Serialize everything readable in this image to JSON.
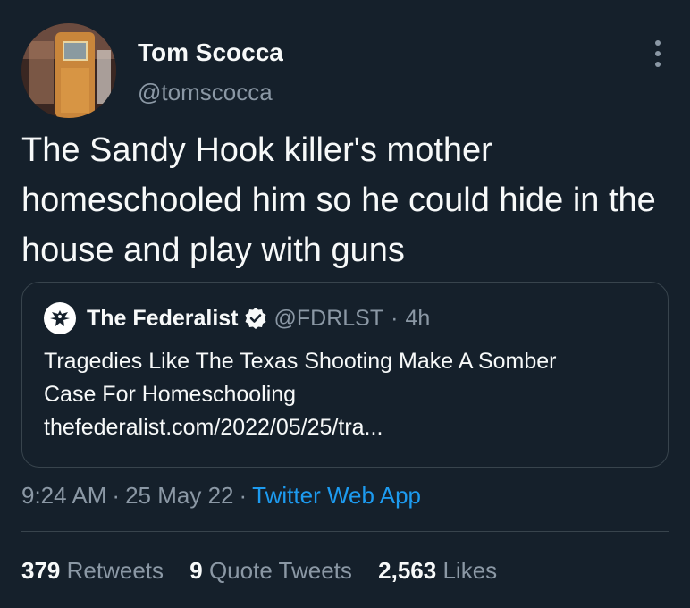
{
  "author": {
    "display_name": "Tom Scocca",
    "handle": "@tomscocca"
  },
  "tweet": {
    "text": "The Sandy Hook killer's mother homeschooled him so he could hide in the house and play with guns"
  },
  "quote": {
    "display_name": "The Federalist",
    "handle": "@FDRLST",
    "dot": "·",
    "time": "4h",
    "text_line_1": "Tragedies Like The Texas Shooting Make A Somber",
    "text_line_2": "Case For Homeschooling",
    "link": "thefederalist.com/2022/05/25/tra..."
  },
  "meta": {
    "time": "9:24 AM",
    "sep1": "·",
    "date": "25 May 22",
    "sep2": "·",
    "app": "Twitter Web App"
  },
  "stats": {
    "retweets_count": "379",
    "retweets_label": "Retweets",
    "quotes_count": "9",
    "quotes_label": "Quote Tweets",
    "likes_count": "2,563",
    "likes_label": "Likes"
  },
  "colors": {
    "background": "#15202b",
    "text": "#f7f9f9",
    "secondary": "#8b98a5",
    "accent": "#1d9bf0",
    "border": "#38444d"
  },
  "icons": {
    "more": "more-vertical-icon",
    "verified": "verified-badge-icon",
    "quote_avatar": "eagle-logo-icon"
  }
}
